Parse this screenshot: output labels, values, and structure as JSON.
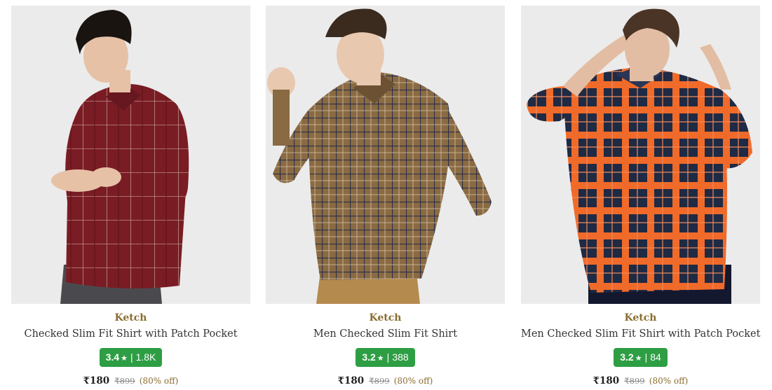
{
  "products": [
    {
      "brand": "Ketch",
      "title": "Checked Slim Fit Shirt with Patch Pocket",
      "rating": "3.4",
      "reviews": "1.8K",
      "price": "₹180",
      "mrp": "₹899",
      "discount": "(80% off)",
      "colors": {
        "shirt": "#7a1c24",
        "check": "#c9a9a0",
        "pants": "#4a4a4e",
        "hair": "#1a1410",
        "skin": "#e6c1a6",
        "background": "#ebebeb"
      }
    },
    {
      "brand": "Ketch",
      "title": "Men Checked Slim Fit Shirt",
      "rating": "3.2",
      "reviews": "388",
      "price": "₹180",
      "mrp": "₹899",
      "discount": "(80% off)",
      "colors": {
        "shirt": "#8a6a42",
        "check": "#2b2f4a",
        "pants": "#b58a4e",
        "hair": "#3b2a1e",
        "skin": "#e9c8b0",
        "background": "#ebebeb"
      }
    },
    {
      "brand": "Ketch",
      "title": "Men Checked Slim Fit Shirt with Patch Pocket",
      "rating": "3.2",
      "reviews": "84",
      "price": "₹180",
      "mrp": "₹899",
      "discount": "(80% off)",
      "colors": {
        "shirt": "#1f2a44",
        "check": "#f06a2a",
        "pants": "#14182e",
        "hair": "#4a3426",
        "skin": "#e2bda3",
        "background": "#ebebeb"
      }
    }
  ],
  "rating_colors": {
    "badge": "#2e9e44",
    "text": "#ffffff"
  },
  "brand_color": "#8a6d2f"
}
